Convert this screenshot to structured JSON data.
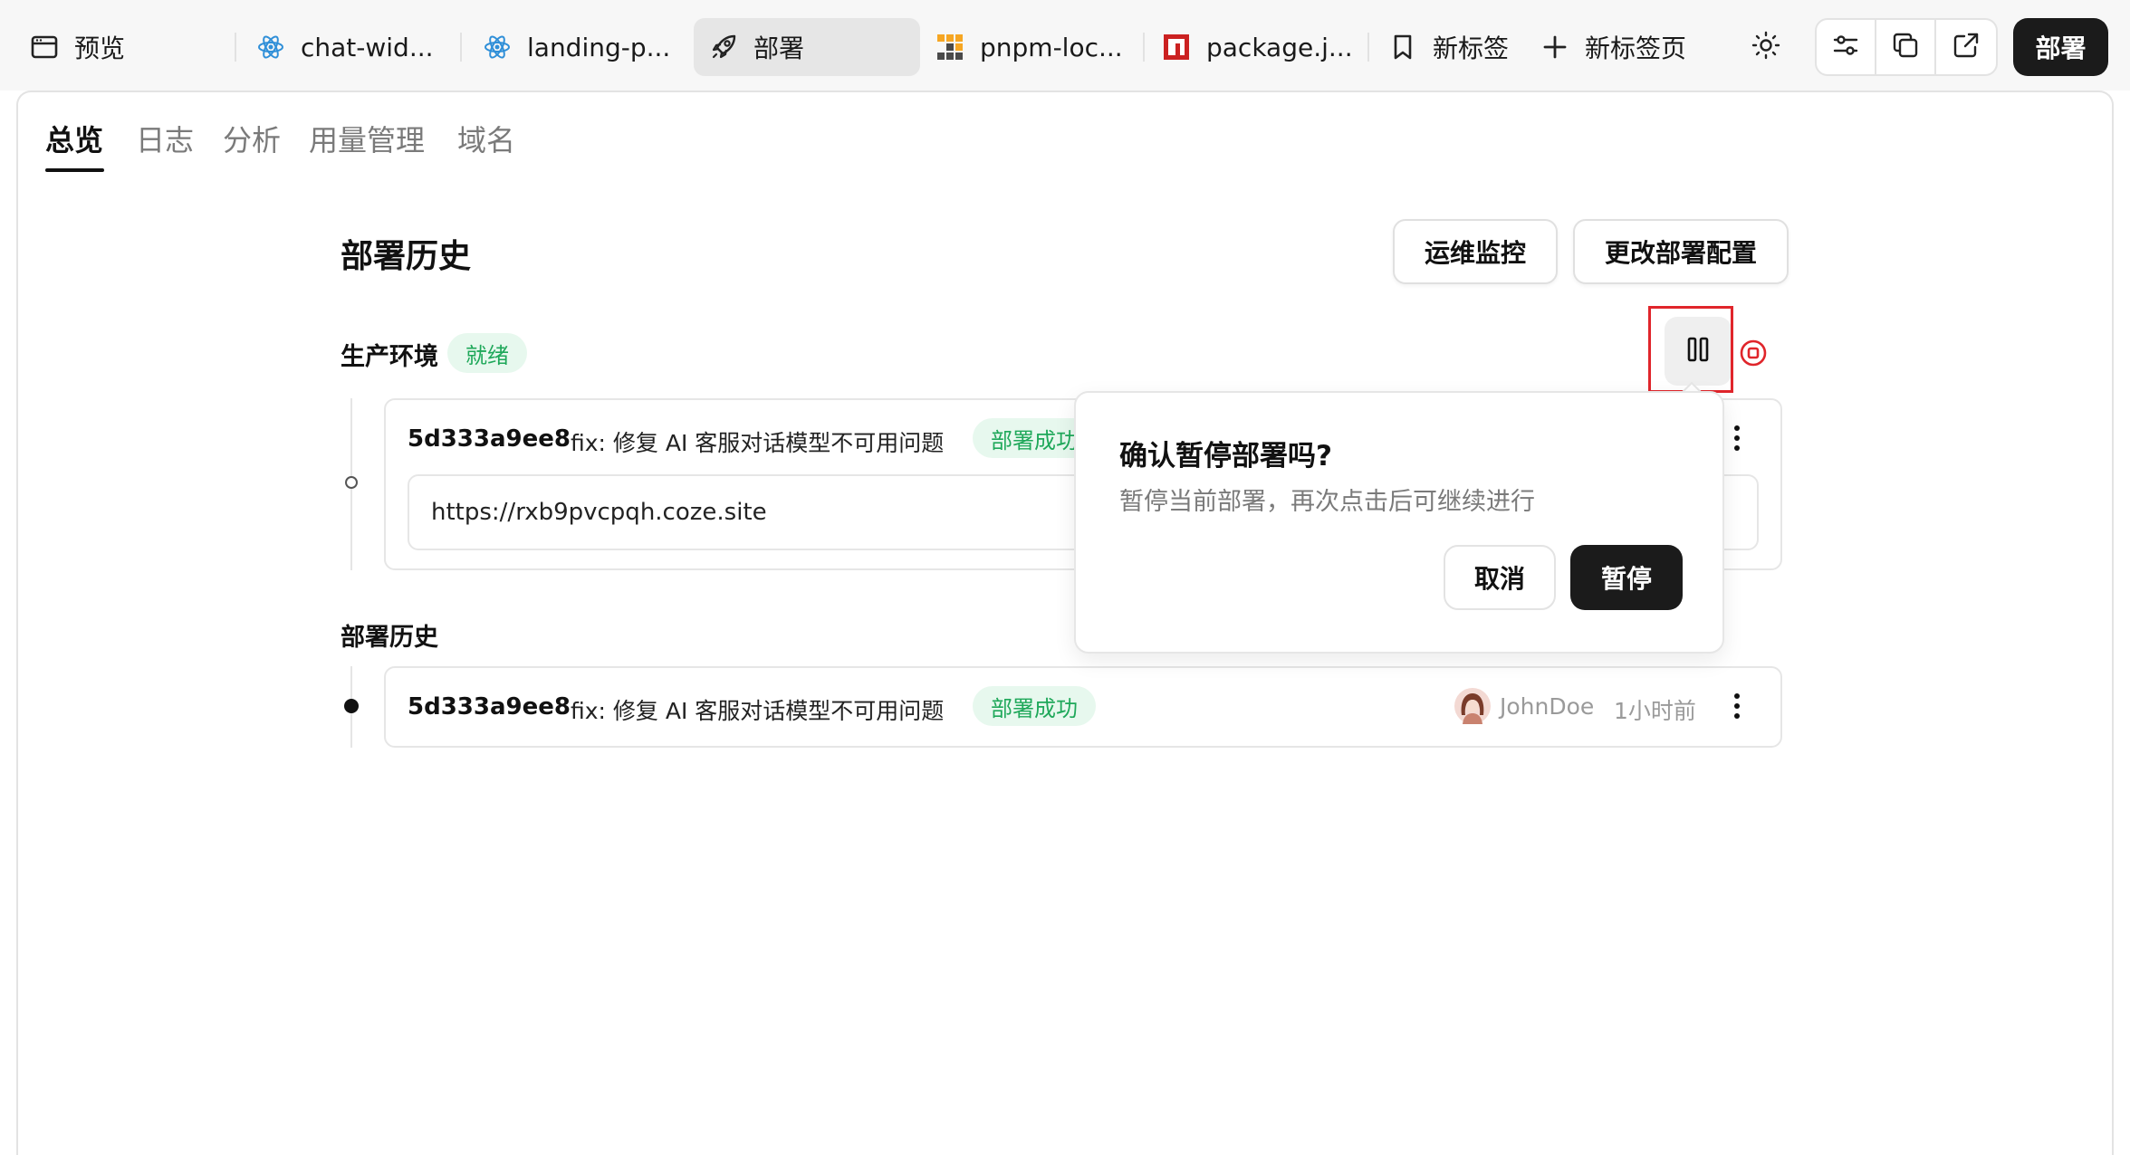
{
  "tabs": [
    {
      "label": "预览",
      "icon": "window-icon"
    },
    {
      "label": "chat-wid...",
      "icon": "react-icon"
    },
    {
      "label": "landing-p...",
      "icon": "react-icon"
    },
    {
      "label": "部署",
      "icon": "rocket-icon",
      "active": true
    },
    {
      "label": "pnpm-loc...",
      "icon": "pnpm-icon"
    },
    {
      "label": "package.j...",
      "icon": "npm-icon"
    },
    {
      "label": "新标签",
      "icon": "bookmark-icon"
    },
    {
      "label": "新标签页",
      "icon": "plus-icon"
    }
  ],
  "toolbar": {
    "deploy_label": "部署"
  },
  "subtabs": [
    "总览",
    "日志",
    "分析",
    "用量管理",
    "域名"
  ],
  "main": {
    "title": "部署历史",
    "monitor_button": "运维监控",
    "config_button": "更改部署配置",
    "env_label": "生产环境",
    "env_status": "就绪",
    "current": {
      "hash": "5d333a9ee8",
      "message": "fix: 修复 AI 客服对话模型不可用问题",
      "status": "部署成功",
      "url": "https://rxb9pvcpqh.coze.site"
    },
    "history_label": "部署历史",
    "history": [
      {
        "hash": "5d333a9ee8",
        "message": "fix: 修复 AI 客服对话模型不可用问题",
        "status": "部署成功",
        "author": "JohnDoe",
        "time": "1小时前"
      }
    ]
  },
  "popconfirm": {
    "title": "确认暂停部署吗?",
    "description": "暂停当前部署，再次点击后可继续进行",
    "cancel": "取消",
    "confirm": "暂停"
  },
  "colors": {
    "success": "#1fa85a",
    "success_bg": "#e7f8ee",
    "highlight": "#e0252b",
    "primary_dark": "#1b1b1b"
  }
}
